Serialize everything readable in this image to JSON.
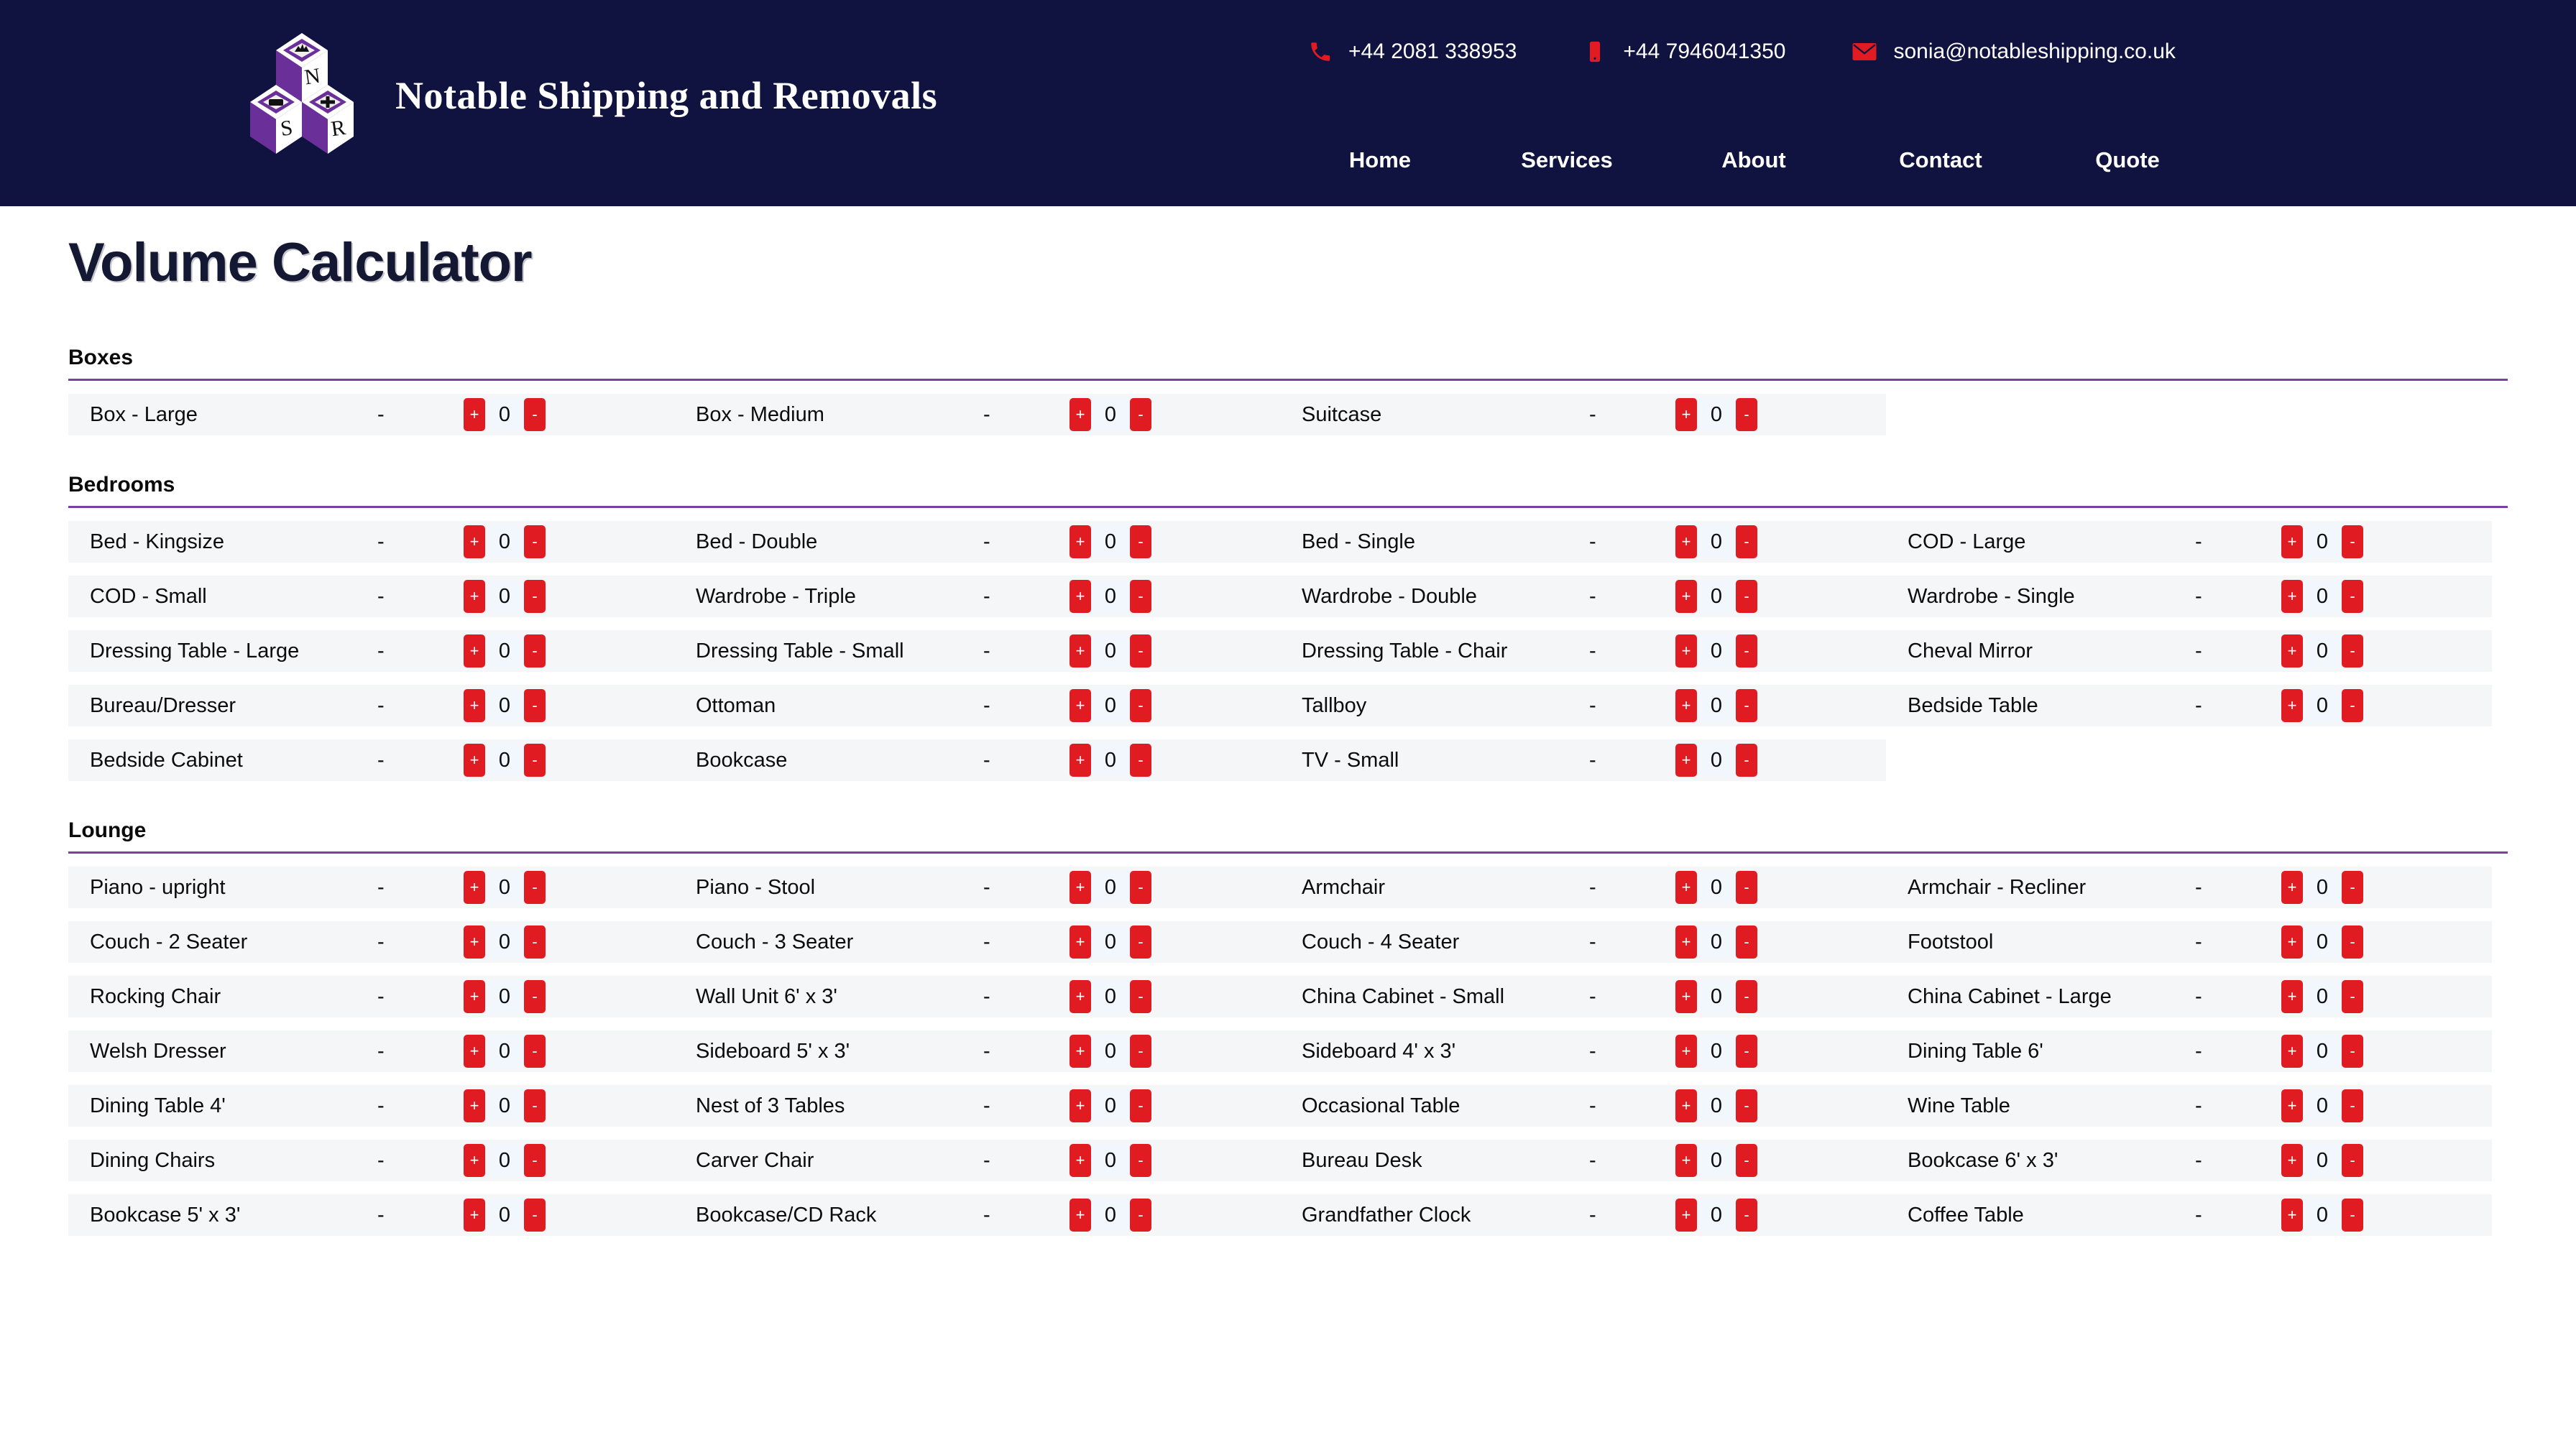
{
  "header": {
    "brand_name": "Notable Shipping and Removals",
    "logo_letters": [
      "N",
      "S",
      "R"
    ],
    "contacts": [
      {
        "icon": "phone-icon",
        "text": "+44 2081 338953"
      },
      {
        "icon": "mobile-icon",
        "text": "+44 7946041350"
      },
      {
        "icon": "envelope-icon",
        "text": "sonia@notableshipping.co.uk"
      }
    ],
    "nav": [
      {
        "label": "Home"
      },
      {
        "label": "Services"
      },
      {
        "label": "About"
      },
      {
        "label": "Contact"
      },
      {
        "label": "Quote"
      }
    ]
  },
  "page": {
    "title": "Volume Calculator"
  },
  "controls": {
    "increment_label": "+",
    "decrement_label": "-",
    "dash": "-",
    "default_value": "0"
  },
  "colors": {
    "header_bg": "#101340",
    "accent_red": "#e11b22",
    "accent_purple": "#7b3fa0",
    "row_bg": "#f5f6f8",
    "value_bg": "#f2f6fd",
    "title": "#141833"
  },
  "sections": [
    {
      "title": "Boxes",
      "rows": [
        [
          {
            "label": "Box - Large",
            "dash": "-",
            "value": "0"
          },
          {
            "label": "Box - Medium",
            "dash": "-",
            "value": "0"
          },
          {
            "label": "Suitcase",
            "dash": "-",
            "value": "0"
          },
          null
        ]
      ]
    },
    {
      "title": "Bedrooms",
      "rows": [
        [
          {
            "label": "Bed - Kingsize",
            "dash": "-",
            "value": "0"
          },
          {
            "label": "Bed - Double",
            "dash": "-",
            "value": "0"
          },
          {
            "label": "Bed - Single",
            "dash": "-",
            "value": "0"
          },
          {
            "label": "COD - Large",
            "dash": "-",
            "value": "0"
          }
        ],
        [
          {
            "label": "COD - Small",
            "dash": "-",
            "value": "0"
          },
          {
            "label": "Wardrobe - Triple",
            "dash": "-",
            "value": "0"
          },
          {
            "label": "Wardrobe - Double",
            "dash": "-",
            "value": "0"
          },
          {
            "label": "Wardrobe - Single",
            "dash": "-",
            "value": "0"
          }
        ],
        [
          {
            "label": "Dressing Table - Large",
            "dash": "-",
            "value": "0"
          },
          {
            "label": "Dressing Table - Small",
            "dash": "-",
            "value": "0"
          },
          {
            "label": "Dressing Table - Chair",
            "dash": "-",
            "value": "0"
          },
          {
            "label": "Cheval Mirror",
            "dash": "-",
            "value": "0"
          }
        ],
        [
          {
            "label": "Bureau/Dresser",
            "dash": "-",
            "value": "0"
          },
          {
            "label": "Ottoman",
            "dash": "-",
            "value": "0"
          },
          {
            "label": "Tallboy",
            "dash": "-",
            "value": "0"
          },
          {
            "label": "Bedside Table",
            "dash": "-",
            "value": "0"
          }
        ],
        [
          {
            "label": "Bedside Cabinet",
            "dash": "-",
            "value": "0"
          },
          {
            "label": "Bookcase",
            "dash": "-",
            "value": "0"
          },
          {
            "label": "TV - Small",
            "dash": "-",
            "value": "0"
          },
          null
        ]
      ]
    },
    {
      "title": "Lounge",
      "rows": [
        [
          {
            "label": "Piano - upright",
            "dash": "-",
            "value": "0"
          },
          {
            "label": "Piano - Stool",
            "dash": "-",
            "value": "0"
          },
          {
            "label": "Armchair",
            "dash": "-",
            "value": "0"
          },
          {
            "label": "Armchair - Recliner",
            "dash": "-",
            "value": "0"
          }
        ],
        [
          {
            "label": "Couch - 2 Seater",
            "dash": "-",
            "value": "0"
          },
          {
            "label": "Couch - 3 Seater",
            "dash": "-",
            "value": "0"
          },
          {
            "label": "Couch - 4 Seater",
            "dash": "-",
            "value": "0"
          },
          {
            "label": "Footstool",
            "dash": "-",
            "value": "0"
          }
        ],
        [
          {
            "label": "Rocking Chair",
            "dash": "-",
            "value": "0"
          },
          {
            "label": "Wall Unit 6' x 3'",
            "dash": "-",
            "value": "0"
          },
          {
            "label": "China Cabinet - Small",
            "dash": "-",
            "value": "0"
          },
          {
            "label": "China Cabinet - Large",
            "dash": "-",
            "value": "0"
          }
        ],
        [
          {
            "label": "Welsh Dresser",
            "dash": "-",
            "value": "0"
          },
          {
            "label": "Sideboard 5' x 3'",
            "dash": "-",
            "value": "0"
          },
          {
            "label": "Sideboard 4' x 3'",
            "dash": "-",
            "value": "0"
          },
          {
            "label": "Dining Table 6'",
            "dash": "-",
            "value": "0"
          }
        ],
        [
          {
            "label": "Dining Table 4'",
            "dash": "-",
            "value": "0"
          },
          {
            "label": "Nest of 3 Tables",
            "dash": "-",
            "value": "0"
          },
          {
            "label": "Occasional Table",
            "dash": "-",
            "value": "0"
          },
          {
            "label": "Wine Table",
            "dash": "-",
            "value": "0"
          }
        ],
        [
          {
            "label": "Dining Chairs",
            "dash": "-",
            "value": "0"
          },
          {
            "label": "Carver Chair",
            "dash": "-",
            "value": "0"
          },
          {
            "label": "Bureau Desk",
            "dash": "-",
            "value": "0"
          },
          {
            "label": "Bookcase 6' x 3'",
            "dash": "-",
            "value": "0"
          }
        ],
        [
          {
            "label": "Bookcase 5' x 3'",
            "dash": "-",
            "value": "0"
          },
          {
            "label": "Bookcase/CD Rack",
            "dash": "-",
            "value": "0"
          },
          {
            "label": "Grandfather Clock",
            "dash": "-",
            "value": "0"
          },
          {
            "label": "Coffee Table",
            "dash": "-",
            "value": "0"
          }
        ]
      ]
    }
  ]
}
